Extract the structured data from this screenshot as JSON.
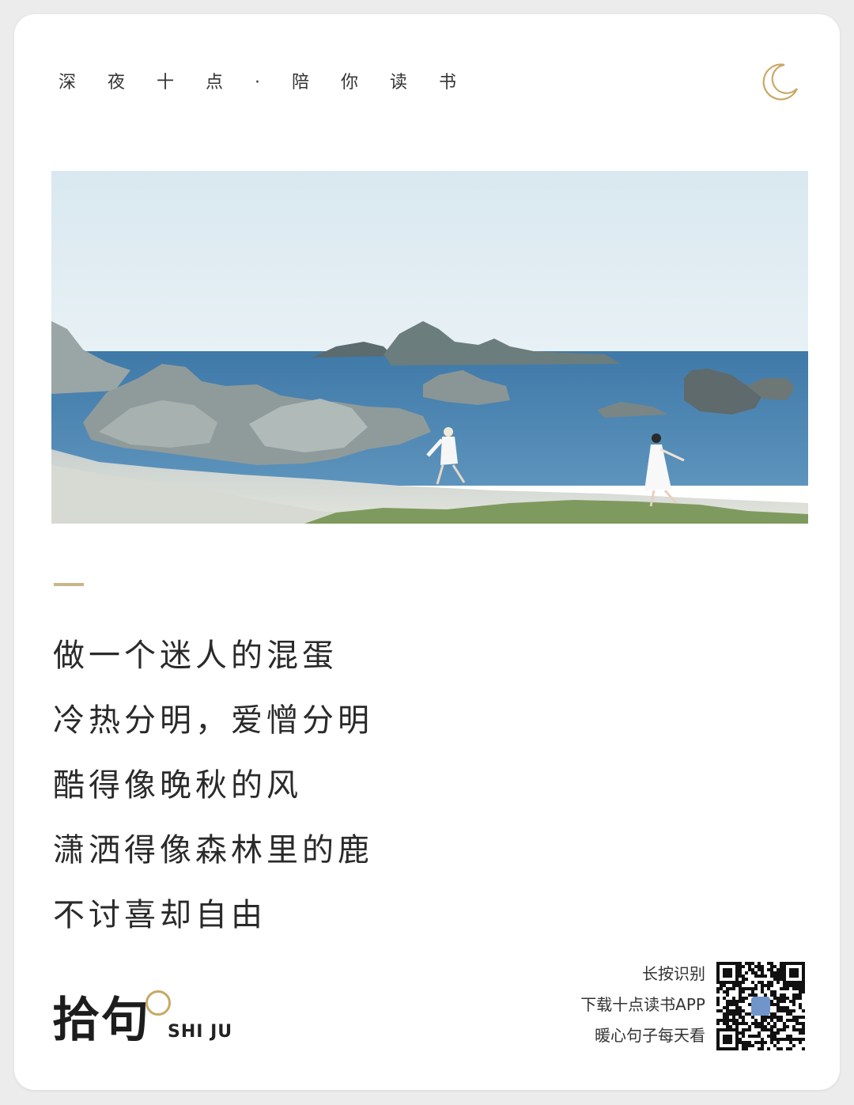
{
  "header": {
    "tagline": "深夜十点·陪你读书"
  },
  "icons": {
    "moon": "crescent-moon-icon",
    "qr": "qr-code"
  },
  "colors": {
    "gold": "#c9b58a",
    "text": "#2a2a2a",
    "background": "#ffffff"
  },
  "poem": {
    "lines": [
      "做一个迷人的混蛋",
      "冷热分明，爱憎分明",
      "酷得像晚秋的风",
      "潇洒得像森林里的鹿",
      "不讨喜却自由"
    ]
  },
  "brand": {
    "name_cn": "拾句",
    "name_en": "SHI JU"
  },
  "promo": {
    "line1": "长按识别",
    "line2": "下载十点读书APP",
    "line3": "暖心句子每天看"
  }
}
